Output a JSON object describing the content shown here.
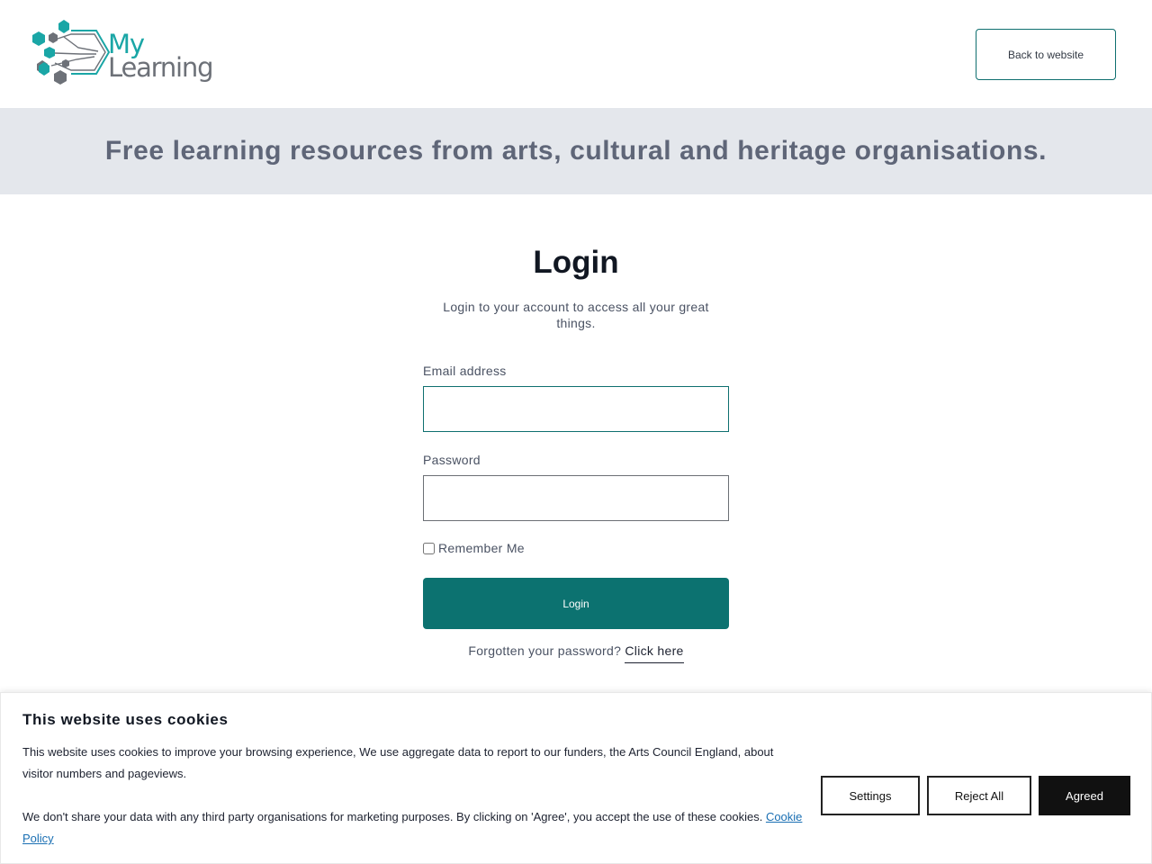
{
  "header": {
    "logo": {
      "line1": "My",
      "line2": "Learning",
      "accent": "#1aa6a6",
      "gray": "#6d7178"
    },
    "back_label": "Back to website"
  },
  "banner": {
    "text": "Free learning resources from arts, cultural and heritage organisations."
  },
  "login": {
    "title": "Login",
    "subtitle": "Login to your account to access all your great things.",
    "email_label": "Email address",
    "email_value": "",
    "password_label": "Password",
    "password_value": "",
    "remember_label": "Remember Me",
    "remember_checked": false,
    "submit_label": "Login",
    "forgot_text": "Forgotten your password?",
    "forgot_link": "Click here",
    "button_color": "#0c7270"
  },
  "cookie": {
    "title": "This website uses cookies",
    "paragraph1": "This website uses cookies to improve your browsing experience, We use aggregate data to report to our funders, the Arts Council England, about visitor numbers and pageviews.",
    "paragraph2": "We don't share your data with any third party organisations for marketing purposes. By clicking on 'Agree', you accept the use of these cookies.",
    "policy_link": "Cookie Policy",
    "settings_label": "Settings",
    "reject_label": "Reject All",
    "agree_label": "Agreed"
  }
}
